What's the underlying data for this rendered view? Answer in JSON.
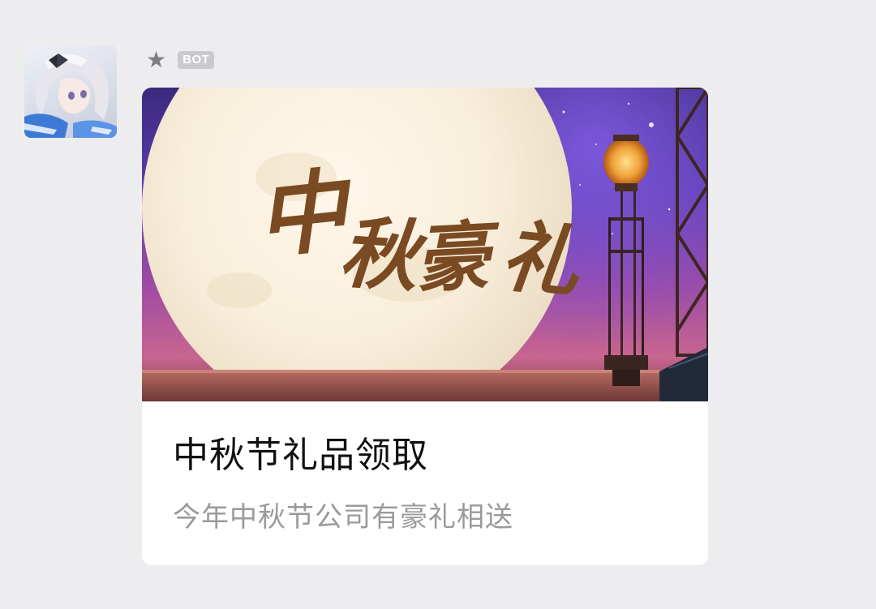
{
  "sender": {
    "avatar_icon": "anime-character-avatar-icon",
    "star_icon": "star-icon",
    "badge": "BOT"
  },
  "card": {
    "banner_calligraphy": "中秋豪礼",
    "title": "中秋节礼品领取",
    "subtitle": "今年中秋节公司有豪礼相送"
  },
  "colors": {
    "background": "#ededf0",
    "card": "#ffffff",
    "title": "#111111",
    "subtitle": "#9a9a9c",
    "badge_bg": "#c9cacd",
    "calligraphy": "#7a4a22"
  }
}
